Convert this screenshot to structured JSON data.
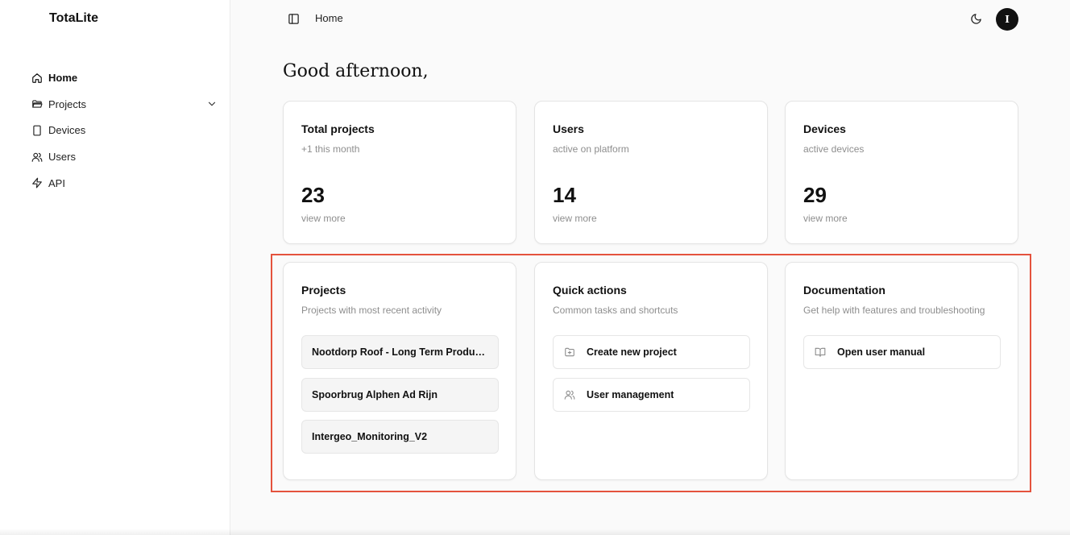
{
  "app": {
    "brand": "TotaLite"
  },
  "sidebar": {
    "items": [
      {
        "label": "Home",
        "icon": "home-icon"
      },
      {
        "label": "Projects",
        "icon": "folder-icon"
      },
      {
        "label": "Devices",
        "icon": "device-icon"
      },
      {
        "label": "Users",
        "icon": "users-icon"
      },
      {
        "label": "API",
        "icon": "zap-icon"
      }
    ]
  },
  "topbar": {
    "title": "Home"
  },
  "user": {
    "initial": "I"
  },
  "greeting": "Good afternoon,",
  "stats": [
    {
      "title": "Total projects",
      "subtitle": "+1 this month",
      "value": "23",
      "link": "view more"
    },
    {
      "title": "Users",
      "subtitle": "active on platform",
      "value": "14",
      "link": "view more"
    },
    {
      "title": "Devices",
      "subtitle": "active devices",
      "value": "29",
      "link": "view more"
    }
  ],
  "projects_card": {
    "title": "Projects",
    "subtitle": "Projects with most recent activity",
    "items": [
      "Nootdorp Roof - Long Term Production Monitoring",
      "Spoorbrug Alphen Ad Rijn",
      "Intergeo_Monitoring_V2"
    ]
  },
  "quick_actions": {
    "title": "Quick actions",
    "subtitle": "Common tasks and shortcuts",
    "items": [
      {
        "label": "Create new project",
        "icon": "folder-plus-icon"
      },
      {
        "label": "User management",
        "icon": "users-icon"
      }
    ]
  },
  "documentation": {
    "title": "Documentation",
    "subtitle": "Get help with features and troubleshooting",
    "items": [
      {
        "label": "Open user manual",
        "icon": "book-open-icon"
      }
    ]
  },
  "colors": {
    "highlight": "#e4523d",
    "avatar_bg": "#111111",
    "muted_text": "#8e8e8e"
  }
}
